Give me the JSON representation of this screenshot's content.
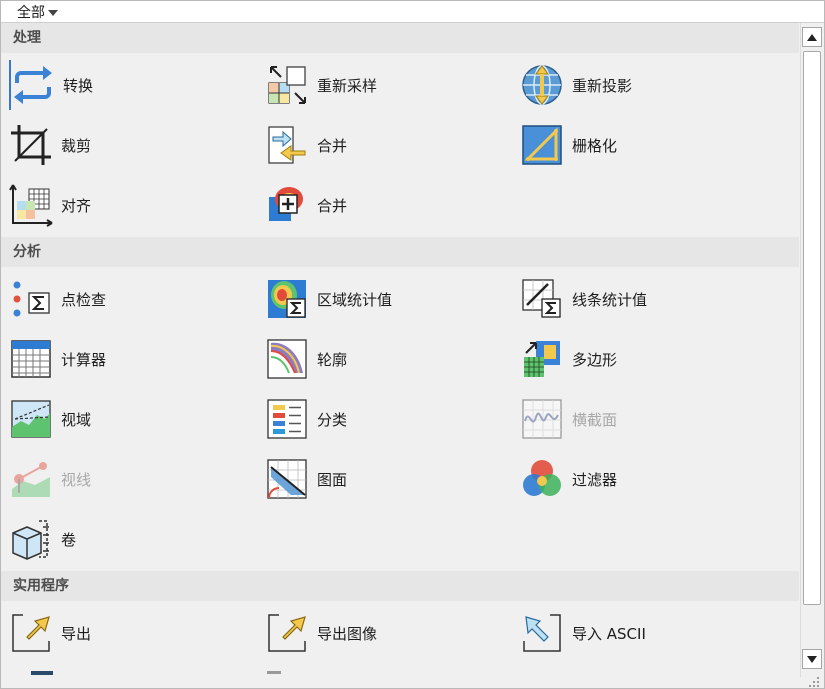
{
  "filter": {
    "selected": "全部"
  },
  "sections": {
    "processing": {
      "title": "处理",
      "tools": [
        {
          "label": "转换",
          "icon": "convert-arrows-icon"
        },
        {
          "label": "重新采样",
          "icon": "resample-icon"
        },
        {
          "label": "重新投影",
          "icon": "reproject-globe-icon"
        },
        {
          "label": "裁剪",
          "icon": "clip-icon"
        },
        {
          "label": "合并",
          "icon": "merge-arrow-icon"
        },
        {
          "label": "栅格化",
          "icon": "rasterize-icon"
        },
        {
          "label": "对齐",
          "icon": "align-grid-icon"
        },
        {
          "label": "合并",
          "icon": "merge-add-icon"
        }
      ]
    },
    "analysis": {
      "title": "分析",
      "tools": [
        {
          "label": "点检查",
          "icon": "point-inspect-icon"
        },
        {
          "label": "区域统计值",
          "icon": "zonal-stats-icon"
        },
        {
          "label": "线条统计值",
          "icon": "line-stats-icon"
        },
        {
          "label": "计算器",
          "icon": "calculator-icon"
        },
        {
          "label": "轮廓",
          "icon": "contour-icon"
        },
        {
          "label": "多边形",
          "icon": "polygon-icon"
        },
        {
          "label": "视域",
          "icon": "viewshed-icon"
        },
        {
          "label": "分类",
          "icon": "classify-icon"
        },
        {
          "label": "横截面",
          "icon": "cross-section-icon"
        },
        {
          "label": "视线",
          "icon": "line-of-sight-icon"
        },
        {
          "label": "图面",
          "icon": "surface-icon"
        },
        {
          "label": "过滤器",
          "icon": "filter-circles-icon"
        },
        {
          "label": "卷",
          "icon": "volume-cube-icon"
        }
      ]
    },
    "utilities": {
      "title": "实用程序",
      "tools": [
        {
          "label": "导出",
          "icon": "export-icon"
        },
        {
          "label": "导出图像",
          "icon": "export-image-icon"
        },
        {
          "label": "导入 ASCII",
          "icon": "import-ascii-icon"
        }
      ]
    }
  },
  "colors": {
    "accent": "#3c78c8",
    "header_bg": "#e6e6e6",
    "panel_bg": "#f0f0f0",
    "disabled_text": "#a8a8a8"
  }
}
